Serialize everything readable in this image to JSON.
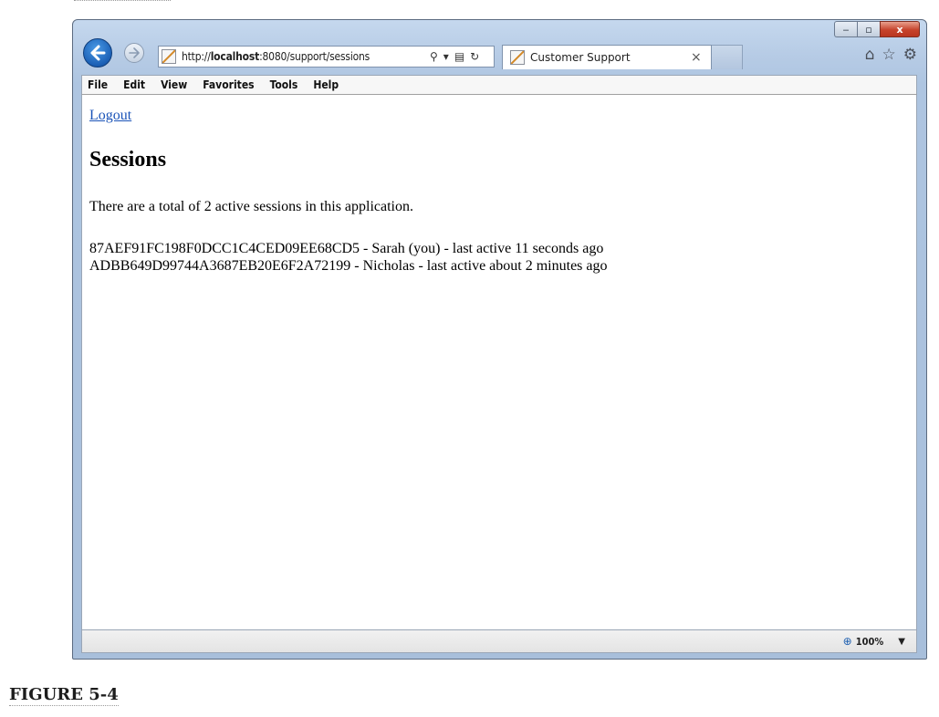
{
  "browser": {
    "url_prefix": "http://",
    "url_host": "localhost",
    "url_rest": ":8080/support/sessions",
    "tab_title": "Customer Support",
    "tab_close": "×",
    "window_controls": {
      "minimize": "‒",
      "maximize": "▫",
      "close": "x"
    },
    "right_icons": [
      "home-icon",
      "star-icon",
      "gear-icon"
    ]
  },
  "menu": [
    "File",
    "Edit",
    "View",
    "Favorites",
    "Tools",
    "Help"
  ],
  "page": {
    "logout_link": "Logout",
    "title": "Sessions",
    "total_text": "There are a total of 2 active sessions in this application.",
    "sessions": [
      "87AEF91FC198F0DCC1C4CED09EE68CD5 - Sarah (you) - last active 11 seconds ago",
      "ADBB649D99744A3687EB20E6F2A72199 - Nicholas - last active about 2 minutes ago"
    ]
  },
  "status": {
    "zoom": "100%"
  },
  "caption": "FIGURE 5-4"
}
